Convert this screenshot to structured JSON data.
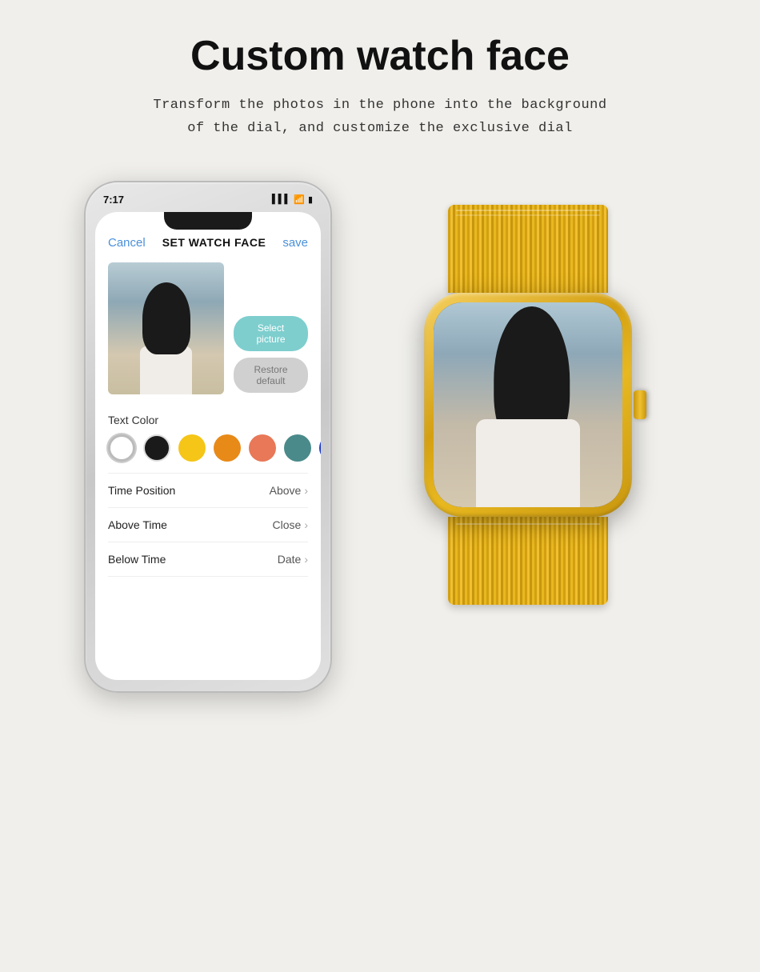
{
  "page": {
    "title": "Custom watch face",
    "subtitle_line1": "Transform the photos in the phone into the background",
    "subtitle_line2": "of the dial, and customize the exclusive dial"
  },
  "phone": {
    "time": "7:17",
    "signal_icon": "signal bars",
    "wifi_icon": "wifi",
    "battery_icon": "battery"
  },
  "app": {
    "cancel_label": "Cancel",
    "title": "SET WATCH FACE",
    "save_label": "save",
    "select_picture_label": "Select picture",
    "restore_default_label": "Restore default",
    "text_color_label": "Text Color",
    "colors": [
      {
        "name": "white",
        "hex": "#ffffff",
        "selected": true
      },
      {
        "name": "black",
        "hex": "#1a1a1a",
        "selected": false
      },
      {
        "name": "yellow",
        "hex": "#f5c518",
        "selected": false
      },
      {
        "name": "orange",
        "hex": "#e88a18",
        "selected": false
      },
      {
        "name": "peach",
        "hex": "#e87858",
        "selected": false
      },
      {
        "name": "teal",
        "hex": "#4a8a8a",
        "selected": false
      },
      {
        "name": "blue",
        "hex": "#1a3acc",
        "selected": false
      }
    ],
    "settings": [
      {
        "label": "Time Position",
        "value": "Above"
      },
      {
        "label": "Above Time",
        "value": "Close"
      },
      {
        "label": "Below Time",
        "value": "Date"
      }
    ]
  }
}
